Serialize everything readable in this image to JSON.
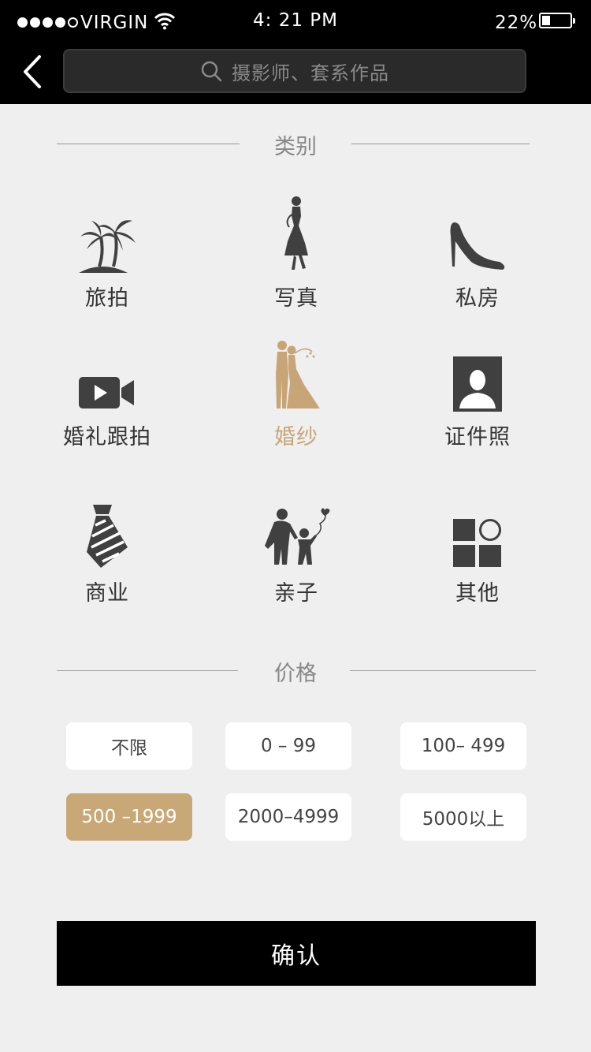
{
  "status_bar": {
    "carrier": "VIRGIN",
    "time": "4: 21 PM",
    "battery": "22%",
    "battery_level": 0.22
  },
  "header": {
    "search_placeholder": "摄影师、套系作品"
  },
  "category_section": {
    "title": "类别",
    "items": [
      {
        "label": "旅拍",
        "icon": "palm-tree-icon",
        "active": false
      },
      {
        "label": "写真",
        "icon": "woman-silhouette-icon",
        "active": false
      },
      {
        "label": "私房",
        "icon": "high-heel-icon",
        "active": false
      },
      {
        "label": "婚礼跟拍",
        "icon": "video-camera-icon",
        "active": false
      },
      {
        "label": "婚纱",
        "icon": "wedding-couple-icon",
        "active": true
      },
      {
        "label": "证件照",
        "icon": "id-photo-icon",
        "active": false
      },
      {
        "label": "商业",
        "icon": "necktie-icon",
        "active": false
      },
      {
        "label": "亲子",
        "icon": "parent-child-icon",
        "active": false
      },
      {
        "label": "其他",
        "icon": "grid-shapes-icon",
        "active": false
      }
    ]
  },
  "price_section": {
    "title": "价格",
    "options": [
      {
        "label": "不限",
        "active": false
      },
      {
        "label": "0 – 99",
        "active": false
      },
      {
        "label": "100– 499",
        "active": false
      },
      {
        "label": "500 –1999",
        "active": true
      },
      {
        "label": "2000–4999",
        "active": false
      },
      {
        "label": "5000以上",
        "active": false
      }
    ]
  },
  "confirm_label": "确认",
  "colors": {
    "accent": "#c9a877",
    "header_bg": "#000000",
    "page_bg": "#efefef"
  }
}
